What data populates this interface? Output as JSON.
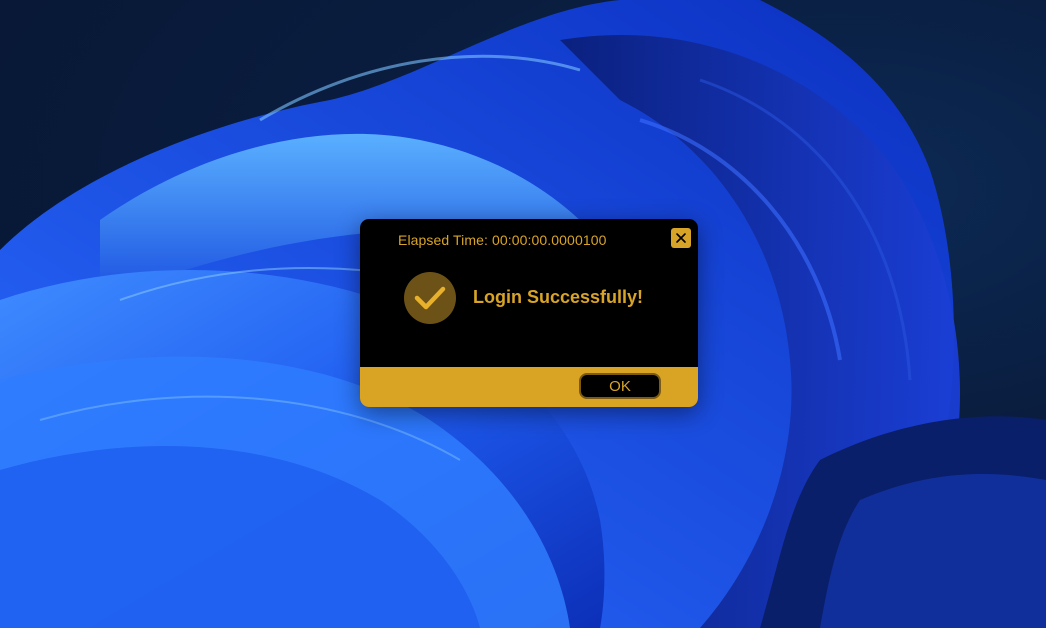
{
  "dialog": {
    "title": "Elapsed Time: 00:00:00.0000100",
    "message": "Login Successfully!",
    "ok_label": "OK",
    "close_icon": "close-icon",
    "status_icon": "check-circle-icon"
  },
  "colors": {
    "accent": "#d9a424",
    "dialog_background": "#000000",
    "icon_circle": "#6d5218"
  }
}
